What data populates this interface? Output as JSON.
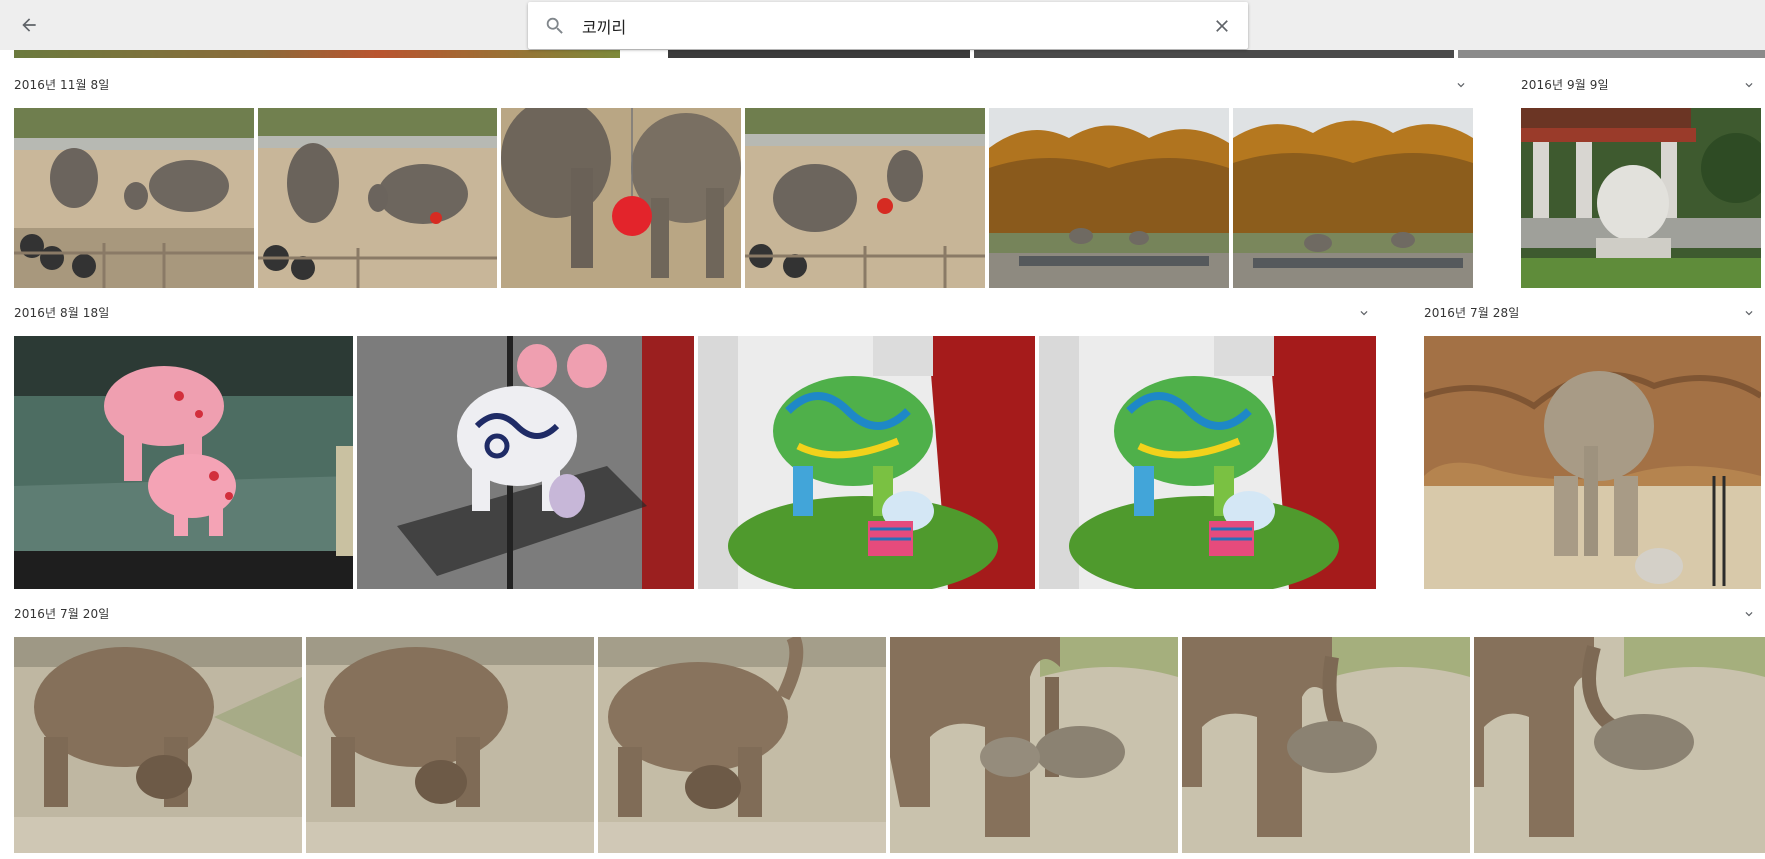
{
  "header": {
    "back_icon": "arrow-back-icon",
    "search_icon": "search-icon",
    "search_query": "코끼리",
    "clear_icon": "close-icon"
  },
  "sections": [
    {
      "date": "2016년 11월 8일",
      "photo_count": 6
    },
    {
      "date": "2016년 9월 9일",
      "photo_count": 1
    },
    {
      "date": "2016년 8월 18일",
      "photo_count": 4
    },
    {
      "date": "2016년 7월 28일",
      "photo_count": 1
    },
    {
      "date": "2016년 7월 20일",
      "photo_count": 6
    }
  ],
  "colors": {
    "header_bg": "#eeeeee",
    "page_bg": "#ffffff",
    "icon": "#5f6368"
  }
}
